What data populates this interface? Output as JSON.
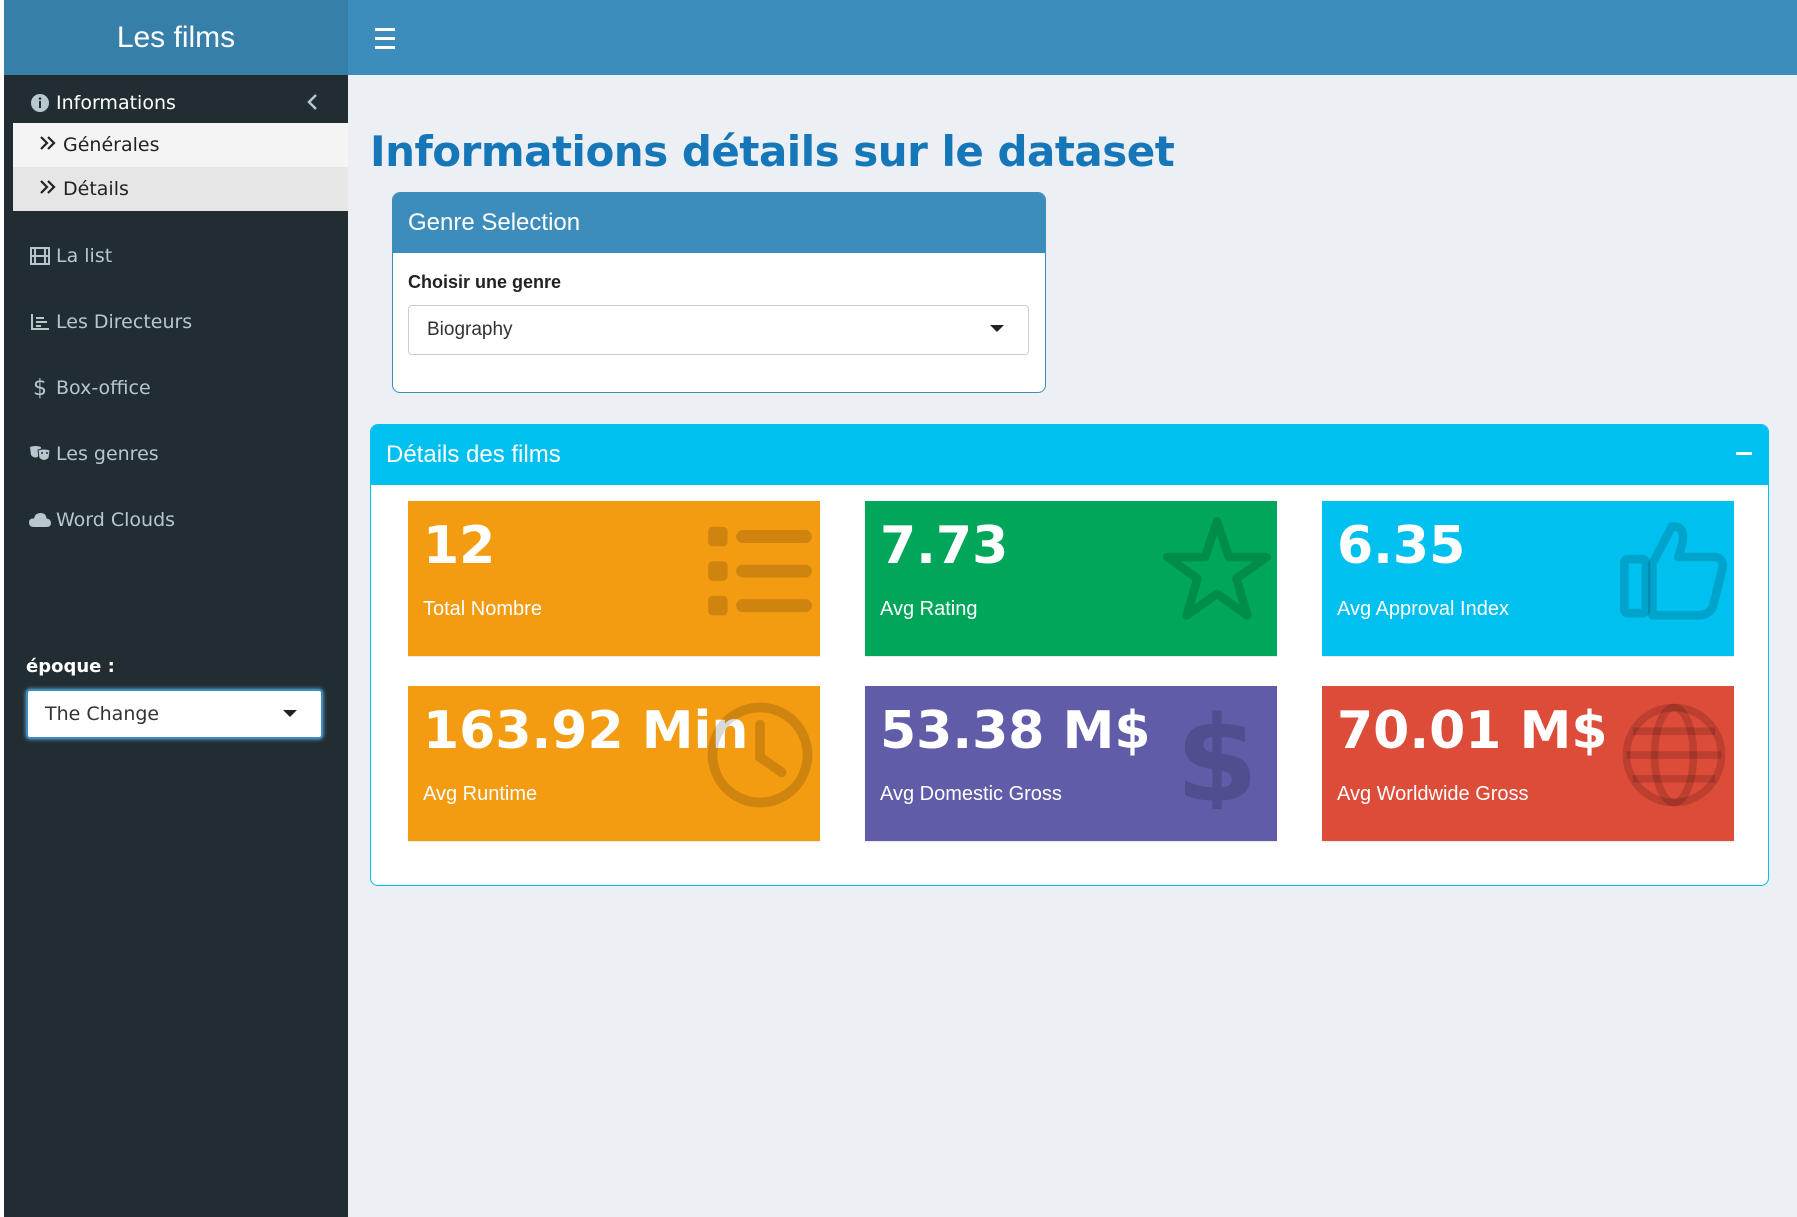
{
  "app": {
    "title": "Les films"
  },
  "sidebar": {
    "items": [
      {
        "label": "Informations",
        "icon": "info-circle-icon"
      },
      {
        "label": "La list",
        "icon": "film-icon"
      },
      {
        "label": "Les Directeurs",
        "icon": "line-chart-icon"
      },
      {
        "label": "Box-office",
        "icon": "dollar-icon"
      },
      {
        "label": "Les genres",
        "icon": "theater-masks-icon"
      },
      {
        "label": "Word Clouds",
        "icon": "cloud-icon"
      }
    ],
    "subitems": [
      {
        "label": "Générales",
        "icon": "double-chevron-right-icon"
      },
      {
        "label": "Détails",
        "icon": "double-chevron-right-icon"
      }
    ],
    "epoque": {
      "label": "époque :",
      "value": "The Change"
    }
  },
  "main": {
    "title": "Informations détails sur le dataset",
    "genre_box": {
      "header": "Genre Selection",
      "field_label": "Choisir une genre",
      "selected": "Biography"
    },
    "details_box": {
      "header": "Détails des films",
      "cards": [
        {
          "value": "12",
          "label": "Total Nombre",
          "icon": "list-icon",
          "color": "#f39c12"
        },
        {
          "value": "7.73",
          "label": "Avg Rating",
          "icon": "star-icon",
          "color": "#00a65a"
        },
        {
          "value": "6.35",
          "label": "Avg Approval Index",
          "icon": "thumbs-up-icon",
          "color": "#00c0ef"
        },
        {
          "value": "163.92 Min",
          "label": "Avg Runtime",
          "icon": "clock-icon",
          "color": "#f39c12"
        },
        {
          "value": "53.38 M$",
          "label": "Avg Domestic Gross",
          "icon": "dollar-icon",
          "color": "#605ca8"
        },
        {
          "value": "70.01 M$",
          "label": "Avg Worldwide Gross",
          "icon": "globe-icon",
          "color": "#dd4b39"
        }
      ]
    }
  },
  "colors": {
    "header": "#3c8dbc",
    "logo": "#367fa9",
    "sidebar": "#222d32",
    "title": "#1576b8",
    "info_box": "#00c0ef"
  }
}
